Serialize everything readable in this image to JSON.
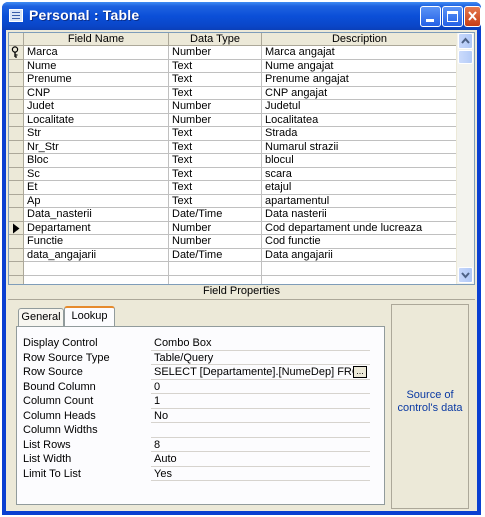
{
  "window": {
    "title": "Personal : Table",
    "buttons": {
      "minimize": "minimize-icon",
      "maximize": "maximize-icon",
      "close": "close-icon"
    }
  },
  "grid": {
    "headers": [
      "Field Name",
      "Data Type",
      "Description"
    ],
    "rows": [
      {
        "name": "Marca",
        "type": "Number",
        "desc": "Marca angajat",
        "marker": "key"
      },
      {
        "name": "Nume",
        "type": "Text",
        "desc": "Nume angajat",
        "marker": ""
      },
      {
        "name": "Prenume",
        "type": "Text",
        "desc": "Prenume angajat",
        "marker": ""
      },
      {
        "name": "CNP",
        "type": "Text",
        "desc": "CNP angajat",
        "marker": ""
      },
      {
        "name": "Judet",
        "type": "Number",
        "desc": "Judetul",
        "marker": ""
      },
      {
        "name": "Localitate",
        "type": "Number",
        "desc": "Localitatea",
        "marker": ""
      },
      {
        "name": "Str",
        "type": "Text",
        "desc": "Strada",
        "marker": ""
      },
      {
        "name": "Nr_Str",
        "type": "Text",
        "desc": "Numarul strazii",
        "marker": ""
      },
      {
        "name": "Bloc",
        "type": "Text",
        "desc": "blocul",
        "marker": ""
      },
      {
        "name": "Sc",
        "type": "Text",
        "desc": "scara",
        "marker": ""
      },
      {
        "name": "Et",
        "type": "Text",
        "desc": "etajul",
        "marker": ""
      },
      {
        "name": "Ap",
        "type": "Text",
        "desc": "apartamentul",
        "marker": ""
      },
      {
        "name": "Data_nasterii",
        "type": "Date/Time",
        "desc": "Data nasterii",
        "marker": ""
      },
      {
        "name": "Departament",
        "type": "Number",
        "desc": "Cod departament unde lucreaza",
        "marker": "current"
      },
      {
        "name": "Functie",
        "type": "Number",
        "desc": "Cod functie",
        "marker": ""
      },
      {
        "name": "data_angajarii",
        "type": "Date/Time",
        "desc": "Data angajarii",
        "marker": ""
      },
      {
        "name": "",
        "type": "",
        "desc": "",
        "marker": ""
      },
      {
        "name": "",
        "type": "",
        "desc": "",
        "marker": ""
      }
    ]
  },
  "field_properties": {
    "label": "Field Properties",
    "tabs": [
      "General",
      "Lookup"
    ],
    "active_tab": "Lookup",
    "properties": [
      {
        "label": "Display Control",
        "value": "Combo Box",
        "builder": false
      },
      {
        "label": "Row Source Type",
        "value": "Table/Query",
        "builder": false
      },
      {
        "label": "Row Source",
        "value": "SELECT [Departamente].[NumeDep] FRC",
        "builder": true
      },
      {
        "label": "Bound Column",
        "value": "0",
        "builder": false
      },
      {
        "label": "Column Count",
        "value": "1",
        "builder": false
      },
      {
        "label": "Column Heads",
        "value": "No",
        "builder": false
      },
      {
        "label": "Column Widths",
        "value": "",
        "builder": false
      },
      {
        "label": "List Rows",
        "value": "8",
        "builder": false
      },
      {
        "label": "List Width",
        "value": "Auto",
        "builder": false
      },
      {
        "label": "Limit To List",
        "value": "Yes",
        "builder": false
      }
    ],
    "builder_label": "...",
    "help_text": "Source of control's data"
  },
  "colors": {
    "title_bar": "#0a46c8",
    "active_tab_accent": "#e68b2c",
    "help_text": "#0b3aa3"
  }
}
